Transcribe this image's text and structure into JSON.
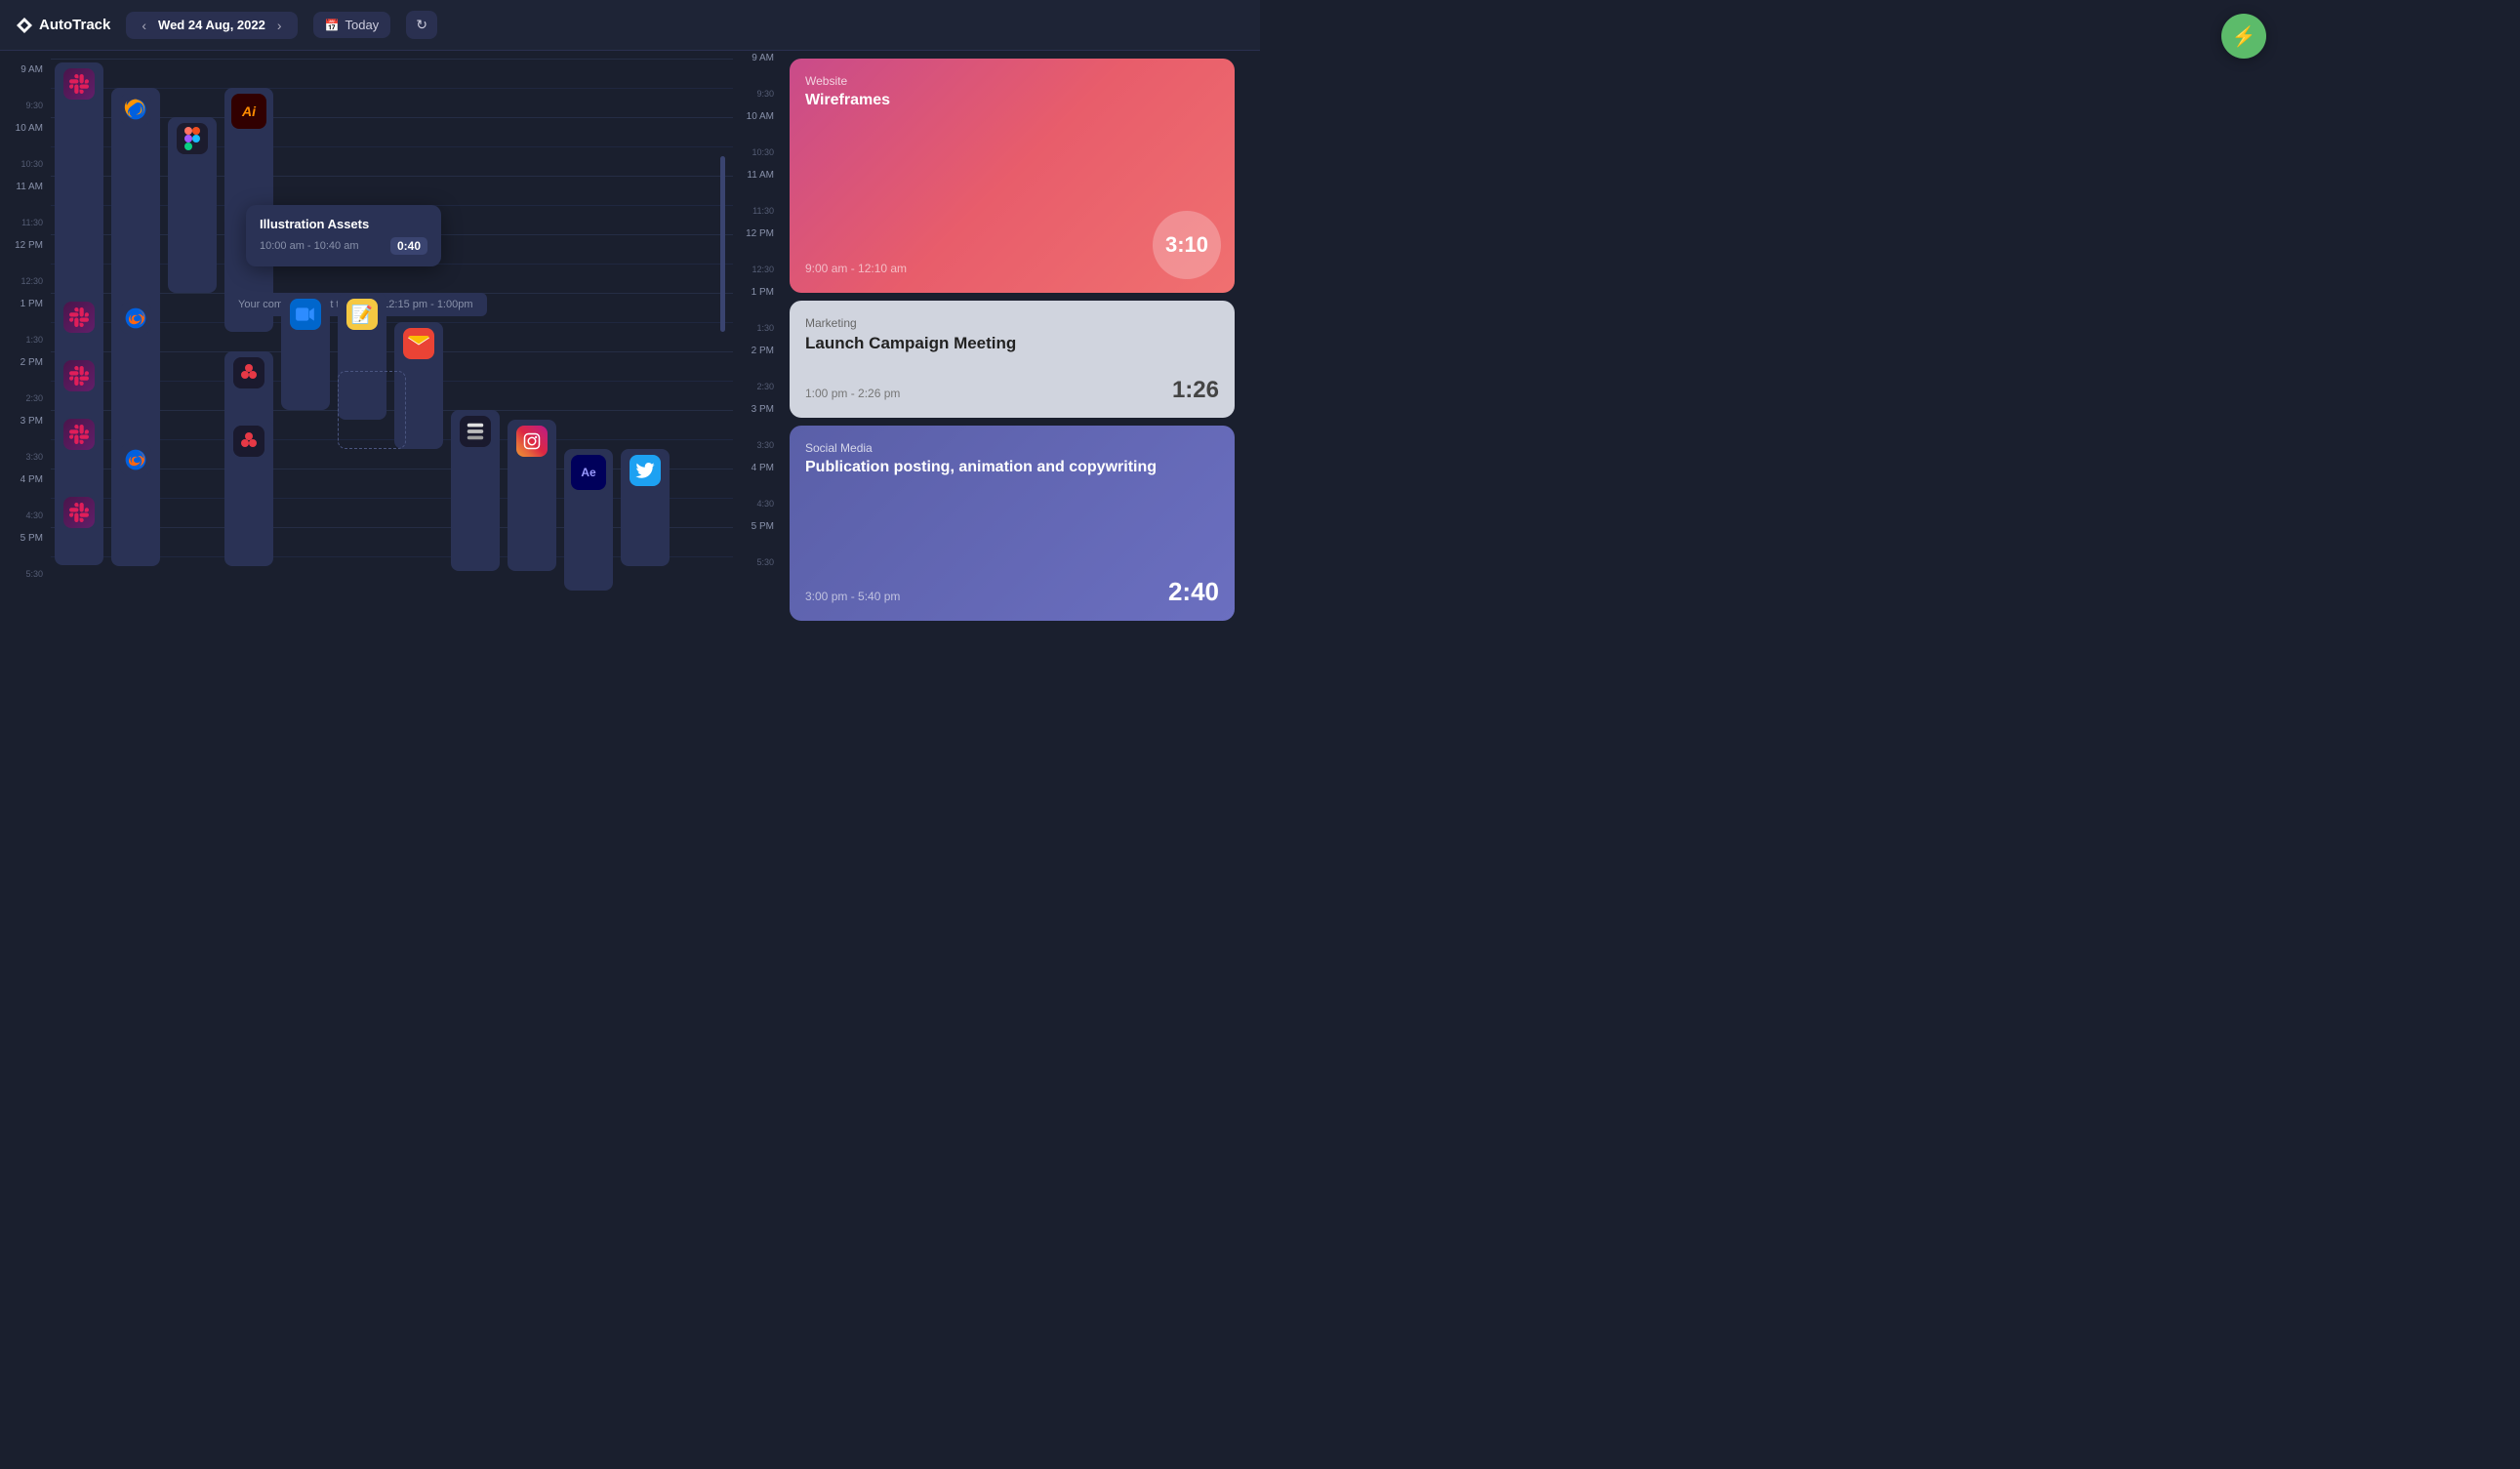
{
  "app": {
    "name": "AutoTrack",
    "logo_symbol": "⚡"
  },
  "header": {
    "date": "Wed 24 Aug, 2022",
    "today_label": "Today",
    "prev_icon": "‹",
    "next_icon": "›",
    "calendar_icon": "📅",
    "refresh_icon": "↻"
  },
  "timeline": {
    "hours": [
      {
        "main": "9 AM",
        "half": "9:30"
      },
      {
        "main": "10 AM",
        "half": "10:30"
      },
      {
        "main": "11 AM",
        "half": "11:30"
      },
      {
        "main": "12 PM",
        "half": "12:30"
      },
      {
        "main": "1 PM",
        "half": "1:30"
      },
      {
        "main": "2 PM",
        "half": "2:30"
      },
      {
        "main": "3 PM",
        "half": "3:30"
      },
      {
        "main": "4 PM",
        "half": "4:30"
      },
      {
        "main": "5 PM",
        "half": "5:30"
      }
    ]
  },
  "sleep_indicator": "Your computer went to sleep / 12:15 pm - 1:00pm",
  "tooltip": {
    "title": "Illustration Assets",
    "time_range": "10:00 am - 10:40 am",
    "duration": "0:40"
  },
  "fab": {
    "icon": "⚡"
  },
  "right_panel": {
    "time_labels": [
      {
        "main": "9 AM",
        "half": "9:30"
      },
      {
        "main": "10 AM",
        "half": "10:30"
      },
      {
        "main": "11 AM",
        "half": "11:30"
      },
      {
        "main": "12 PM",
        "half": "12:30"
      },
      {
        "main": "1 PM",
        "half": "1:30"
      },
      {
        "main": "2 PM",
        "half": "2:30"
      },
      {
        "main": "3 PM",
        "half": "3:30"
      },
      {
        "main": "4 PM",
        "half": "4:30"
      },
      {
        "main": "5 PM",
        "half": "5:30"
      }
    ],
    "cards": [
      {
        "id": "website",
        "label": "Website",
        "title": "Wireframes",
        "time_range": "9:00 am - 12:10 am",
        "duration": "3:10",
        "type": "website"
      },
      {
        "id": "marketing",
        "label": "Marketing",
        "title": "Launch Campaign Meeting",
        "time_range": "1:00 pm - 2:26 pm",
        "duration": "1:26",
        "type": "marketing"
      },
      {
        "id": "social",
        "label": "Social Media",
        "title": "Publication posting, animation and copywriting",
        "time_range": "3:00 pm - 5:40 pm",
        "duration": "2:40",
        "type": "social"
      }
    ]
  },
  "colors": {
    "bg": "#1a1f2e",
    "header_bg": "#1e2436",
    "block_bg": "#2a3255",
    "accent_green": "#5cbb6a",
    "website_gradient_start": "#c94b8a",
    "website_gradient_end": "#f07070",
    "marketing_bg": "#d0d4de",
    "social_gradient_start": "#5a5fa8",
    "social_gradient_end": "#6b6fc0"
  }
}
